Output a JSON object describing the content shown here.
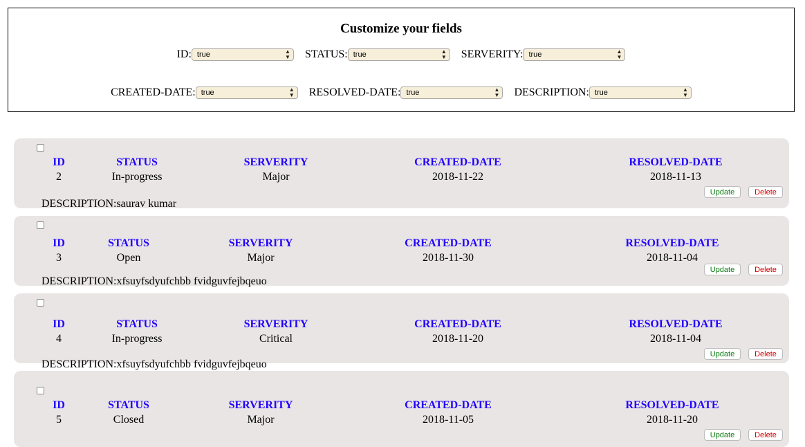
{
  "panel": {
    "title": "Customize your fields",
    "fields_row1": [
      {
        "label": "ID:",
        "value": "true"
      },
      {
        "label": "STATUS:",
        "value": "true"
      },
      {
        "label": "SERVERITY:",
        "value": "true"
      }
    ],
    "fields_row2": [
      {
        "label": "CREATED-DATE:",
        "value": "true"
      },
      {
        "label": "RESOLVED-DATE:",
        "value": "true"
      },
      {
        "label": "DESCRIPTION:",
        "value": "true"
      }
    ]
  },
  "headers": {
    "id": "ID",
    "status": "STATUS",
    "severity": "SERVERITY",
    "created": "CREATED-DATE",
    "resolved": "RESOLVED-DATE",
    "description_prefix": "DESCRIPTION:"
  },
  "buttons": {
    "update": "Update",
    "delete": "Delete"
  },
  "issues": [
    {
      "id": "2",
      "status": "In-progress",
      "severity": "Major",
      "created": "2018-11-22",
      "resolved": "2018-11-13",
      "description": "DESCRIPTION:saurav kumar"
    },
    {
      "id": "3",
      "status": "Open",
      "severity": "Major",
      "created": "2018-11-30",
      "resolved": "2018-11-04",
      "description": "DESCRIPTION:xfsuyfsdyufchbb fvidguvfejbqeuo"
    },
    {
      "id": "4",
      "status": "In-progress",
      "severity": "Critical",
      "created": "2018-11-20",
      "resolved": "2018-11-04",
      "description": "DESCRIPTION:xfsuyfsdyufchbb fvidguvfejbqeuo"
    },
    {
      "id": "5",
      "status": "Closed",
      "severity": "Major",
      "created": "2018-11-05",
      "resolved": "2018-11-20",
      "description": ""
    }
  ]
}
